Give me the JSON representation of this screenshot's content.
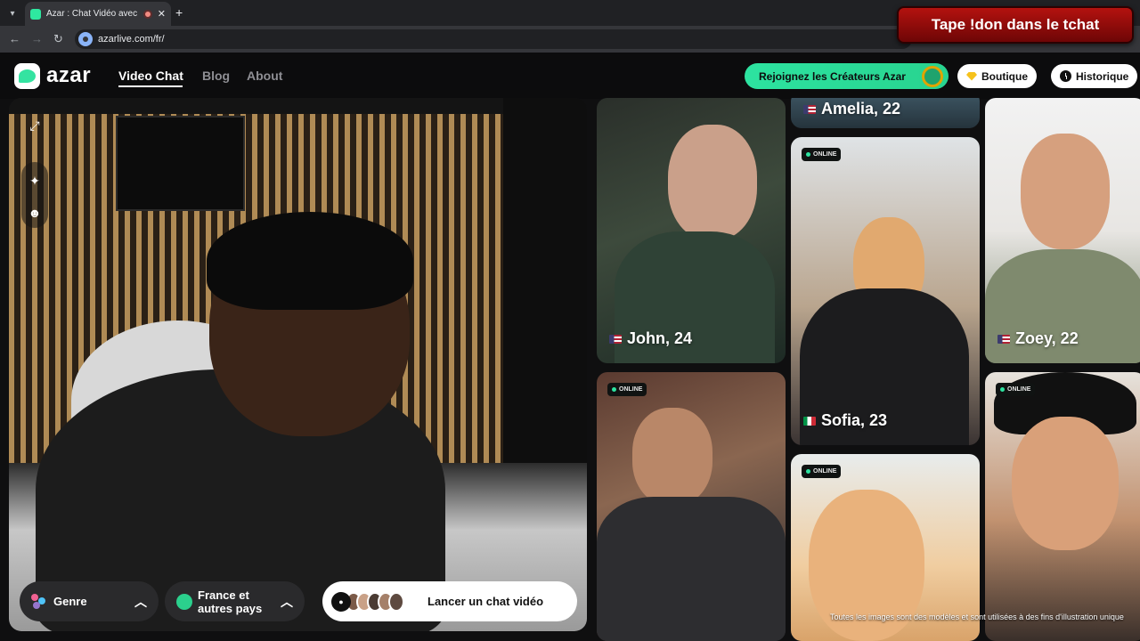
{
  "browser": {
    "tab_title": "Azar : Chat Vidéo avec de n",
    "url": "azarlive.com/fr/",
    "new_tab": "+",
    "close": "✕"
  },
  "overlay_banner": "Tape !don dans le tchat",
  "header": {
    "logo": "azar",
    "nav": [
      "Video Chat",
      "Blog",
      "About"
    ],
    "creators_button": "Rejoignez les Créateurs Azar",
    "shop_button": "Boutique",
    "history_button": "Historique"
  },
  "video_panel": {
    "genre_label": "Genre",
    "country_label_line1": "France et",
    "country_label_line2": "autres pays",
    "cta_label": "Lancer un chat vidéo"
  },
  "gallery": {
    "cards": [
      {
        "name": "John, 24",
        "online": false
      },
      {
        "name": "Amelia, 22",
        "online": false
      },
      {
        "name": "Sofia, 23",
        "online": true
      },
      {
        "name": "Zoey, 22",
        "online": false
      },
      {
        "name": "",
        "online": true
      },
      {
        "name": "",
        "online": true
      },
      {
        "name": "",
        "online": true
      }
    ],
    "online_label": "ONLINE",
    "disclaimer": "Toutes les images sont des modèles et sont utilisées à des fins d'illustration unique"
  },
  "colors": {
    "accent": "#2de3a0",
    "banner": "#b3120f"
  },
  "icons": [
    "tab-search-icon",
    "back-icon",
    "forward-icon",
    "reload-icon",
    "site-info-icon",
    "expand-icon",
    "sparkle-icon",
    "face-filter-icon",
    "genre-icon",
    "globe-icon",
    "chevron-up-icon",
    "camera-icon",
    "gem-icon",
    "clock-icon"
  ]
}
